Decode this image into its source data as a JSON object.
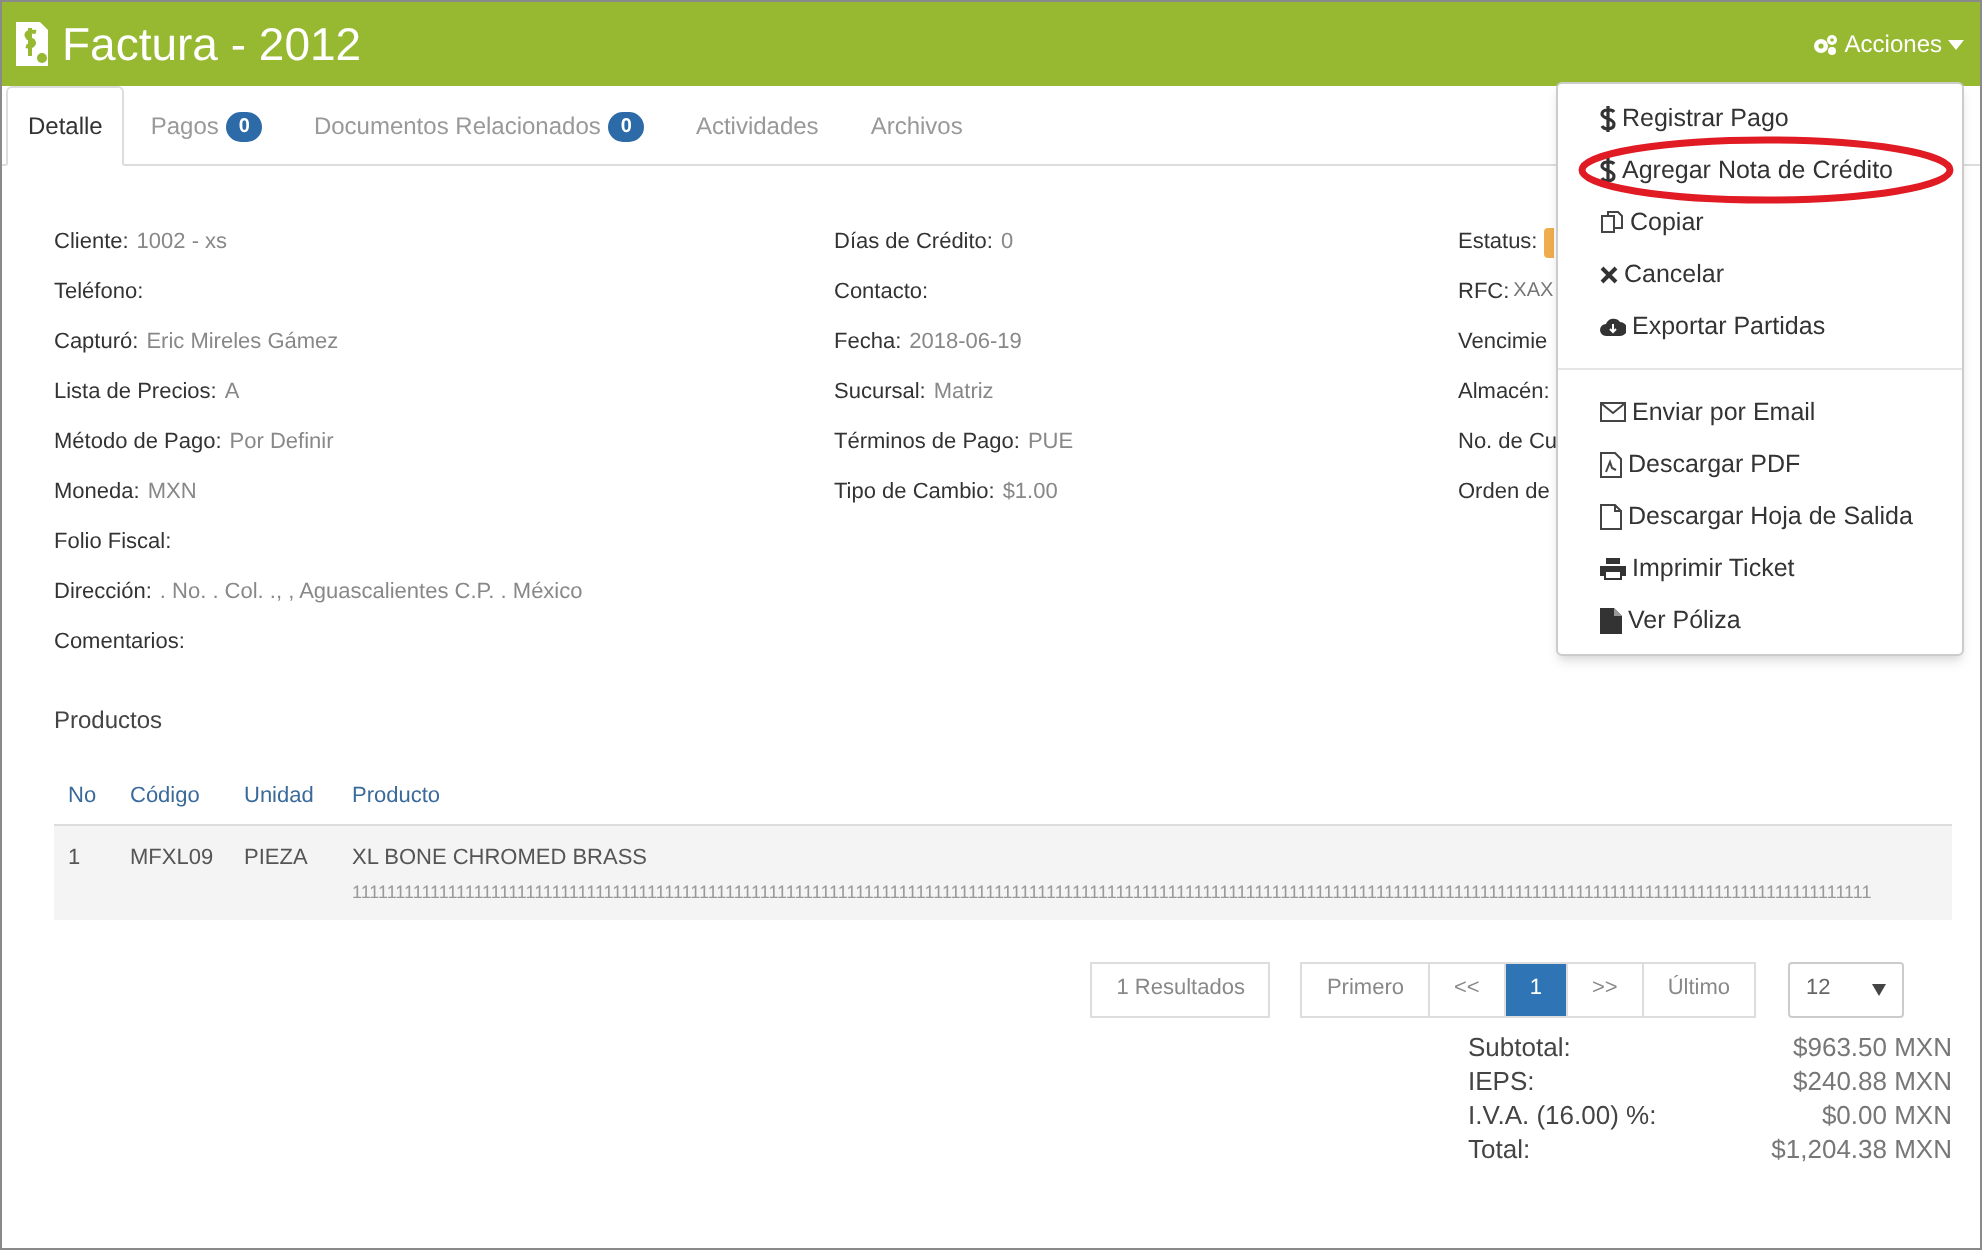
{
  "header": {
    "title": "Factura - 2012",
    "actions_button": "Acciones"
  },
  "tabs": [
    {
      "label": "Detalle",
      "selected": true
    },
    {
      "label": "Pagos",
      "badge": "0",
      "selected": false
    },
    {
      "label": "Documentos Relacionados",
      "badge": "0",
      "selected": false
    },
    {
      "label": "Actividades",
      "selected": false
    },
    {
      "label": "Archivos",
      "selected": false
    }
  ],
  "details": [
    [
      {
        "label": "Cliente:",
        "value": "1002 - xs"
      },
      {
        "label": "Teléfono:"
      },
      {
        "label": "Capturó:",
        "value": "Eric Mireles Gámez"
      },
      {
        "label": "Lista de Precios:",
        "value": "A"
      },
      {
        "label": "Método de Pago:",
        "value": "Por Definir"
      },
      {
        "label": "Moneda:",
        "value": "MXN"
      },
      {
        "label": "Folio Fiscal:"
      },
      {
        "label": "Dirección:",
        "value": ". No. . Col. ., , Aguascalientes C.P. . México"
      },
      {
        "label": "Comentarios:"
      }
    ],
    [
      {
        "label": "Días de Crédito:",
        "value": "0"
      },
      {
        "label": "Contacto:"
      },
      {
        "label": "Fecha:",
        "value": "2018-06-19"
      },
      {
        "label": "Sucursal:",
        "value": "Matriz"
      },
      {
        "label": "Términos de Pago:",
        "value": "PUE"
      },
      {
        "label": "Tipo de Cambio:",
        "value": "$1.00"
      }
    ],
    [
      {
        "label": "Estatus:"
      },
      {
        "label": "RFC:",
        "value": "XAX"
      },
      {
        "label": "Vencimie"
      },
      {
        "label": "Almacén:"
      },
      {
        "label": "No. de Cu"
      },
      {
        "label": "Orden de"
      }
    ]
  ],
  "products": {
    "title": "Productos",
    "columns": [
      "No",
      "Código",
      "Unidad",
      "Producto"
    ],
    "rows": [
      {
        "no": "1",
        "code": "MFXL09",
        "unit": "PIEZA",
        "product": "XL BONE CHROMED BRASS",
        "description": "1111111111111111111111111111111111111111111111111111111111111111111111111111111111111111111111111111111111111111111111111111111111111111111111111111111111111111111111111111111"
      }
    ]
  },
  "pagination": {
    "results": "1 Resultados",
    "pages": [
      {
        "label": "Primero",
        "selected": false
      },
      {
        "label": "<<",
        "selected": false
      },
      {
        "label": "1",
        "selected": true
      },
      {
        "label": ">>",
        "selected": false
      },
      {
        "label": "Último",
        "selected": false
      }
    ],
    "page_size": "12"
  },
  "totals": [
    {
      "label": "Subtotal:",
      "value": "$963.50 MXN"
    },
    {
      "label": "IEPS:",
      "value": "$240.88 MXN"
    },
    {
      "label": "I.V.A. (16.00) %:",
      "value": "$0.00 MXN"
    },
    {
      "label": "Total:",
      "value": "$1,204.38 MXN"
    }
  ],
  "actions_menu": {
    "groups": [
      [
        {
          "label": "Registrar Pago",
          "kind": "dollar",
          "circled": false
        },
        {
          "label": "Agregar Nota de Crédito",
          "kind": "dollar",
          "circled": true
        },
        {
          "label": "Copiar",
          "kind": "copy",
          "circled": false
        },
        {
          "label": "Cancelar",
          "kind": "x",
          "circled": false
        },
        {
          "label": "Exportar Partidas",
          "kind": "cloud",
          "circled": false
        }
      ],
      [
        {
          "label": "Enviar por Email",
          "kind": "mail",
          "circled": false
        },
        {
          "label": "Descargar PDF",
          "kind": "pdf",
          "circled": false
        },
        {
          "label": "Descargar Hoja de Salida",
          "kind": "file",
          "circled": false
        },
        {
          "label": "Imprimir Ticket",
          "kind": "print",
          "circled": false
        },
        {
          "label": "Ver Póliza",
          "kind": "filled-file",
          "circled": false
        }
      ]
    ]
  }
}
